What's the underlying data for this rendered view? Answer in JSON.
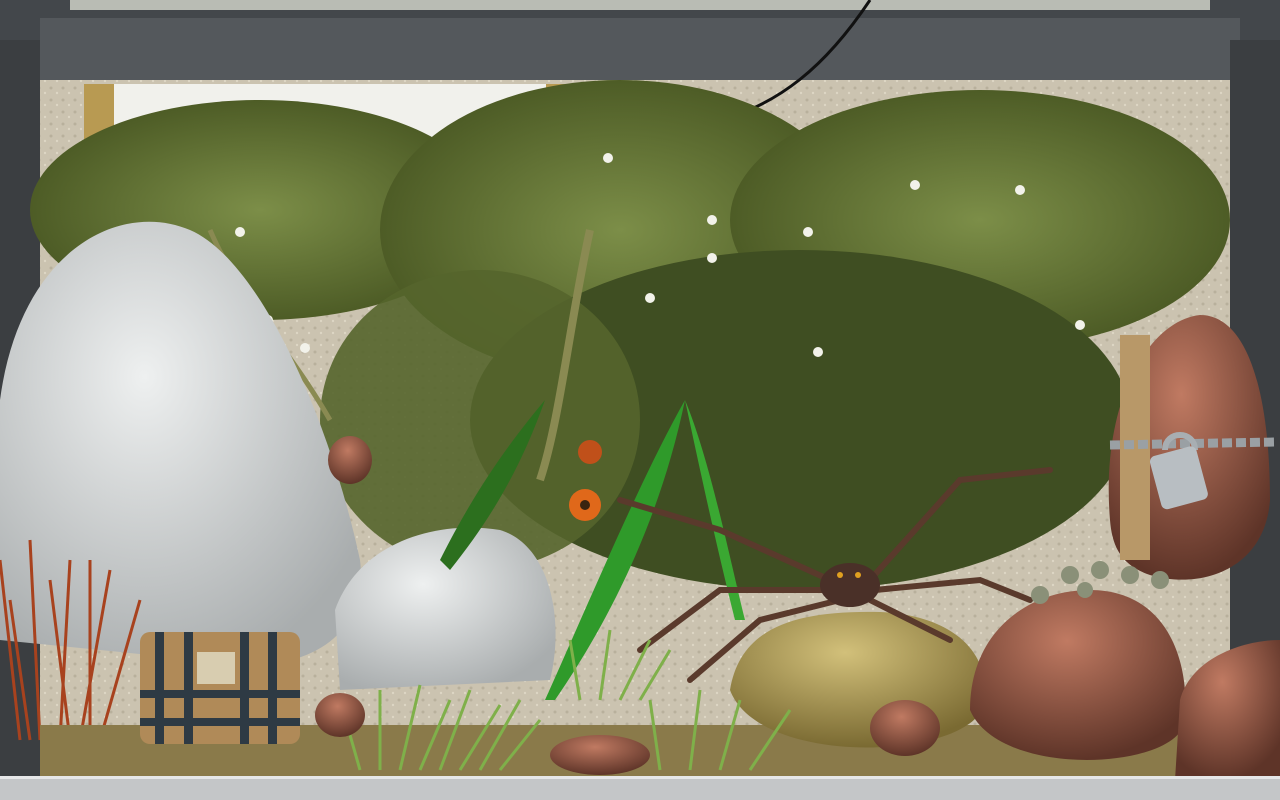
{
  "scene": {
    "colors": {
      "frame": "#4a4e52",
      "wall": "#cfc7b4",
      "light_panel": "#f2f2ee",
      "foliage": "#6f8040",
      "foliage_dark": "#3f4e22",
      "white_rock": "#d9dcdc",
      "red_rock": "#9a5a48",
      "pot": "#b8a45a",
      "chest_wood": "#b08a58",
      "chest_band": "#2e3a44",
      "red_grass": "#a8421e",
      "grass": "#7fb04a",
      "leaf": "#2f9a2a",
      "flower": "#e0681a",
      "spider": "#4a3028",
      "floor": "#c4c6c8"
    }
  }
}
